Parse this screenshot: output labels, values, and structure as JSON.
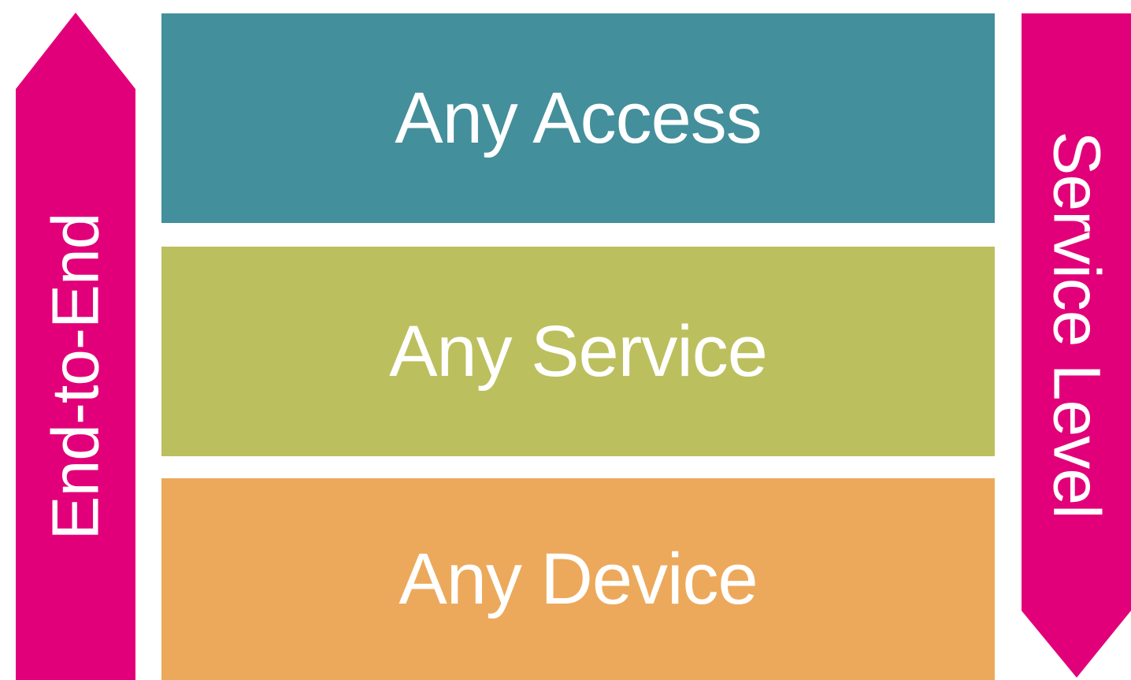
{
  "colors": {
    "arrow": "#e2007a",
    "access": "#438f9b",
    "service": "#bcbf5d",
    "device": "#eca95b",
    "text": "#ffffff"
  },
  "left_arrow": {
    "label": "End-to-End",
    "direction": "up"
  },
  "right_arrow": {
    "label": "Service Level",
    "direction": "down"
  },
  "blocks": [
    {
      "label": "Any Access"
    },
    {
      "label": "Any Service"
    },
    {
      "label": "Any Device"
    }
  ]
}
